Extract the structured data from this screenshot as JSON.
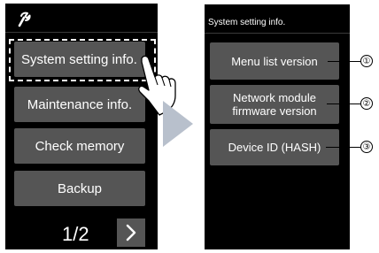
{
  "left_screen": {
    "icon": "wrench-icon",
    "buttons": [
      {
        "label": "System setting info."
      },
      {
        "label": "Maintenance info."
      },
      {
        "label": "Check memory"
      },
      {
        "label": "Backup"
      }
    ],
    "page_indicator": "1/2",
    "next_icon": "chevron-right-icon"
  },
  "right_screen": {
    "title": "System setting info.",
    "buttons": [
      {
        "label": "Menu list version",
        "callout": "①"
      },
      {
        "label": "Network module firmware version",
        "callout": "②"
      },
      {
        "label": "Device ID (HASH)",
        "callout": "③"
      }
    ]
  },
  "colors": {
    "panel": "#000000",
    "button": "#555555",
    "text": "#ffffff",
    "arrow": "#b8c0cc"
  }
}
